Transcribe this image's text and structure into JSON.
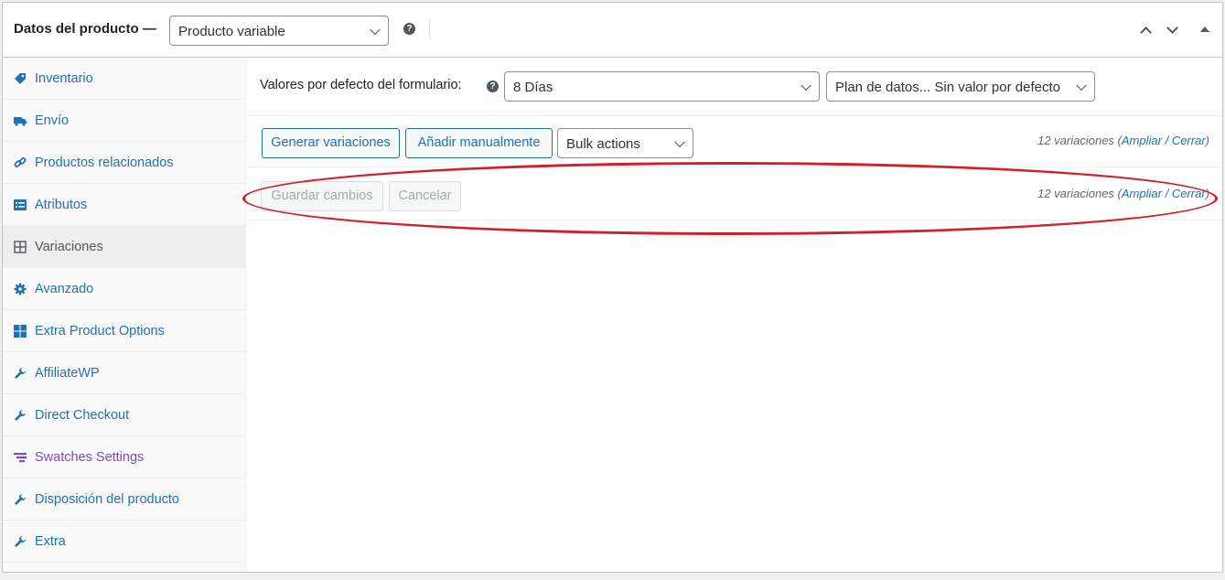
{
  "header": {
    "title": "Datos del producto —",
    "product_type": "Producto variable",
    "help": "?"
  },
  "sidebar": {
    "items": [
      {
        "label": "Inventario",
        "icon": "tag-icon"
      },
      {
        "label": "Envío",
        "icon": "truck-icon"
      },
      {
        "label": "Productos relacionados",
        "icon": "link-icon"
      },
      {
        "label": "Atributos",
        "icon": "list-icon"
      },
      {
        "label": "Variaciones",
        "icon": "grid-icon",
        "active": true
      },
      {
        "label": "Avanzado",
        "icon": "gear-icon"
      },
      {
        "label": "Extra Product Options",
        "icon": "dashboard-icon"
      },
      {
        "label": "AffiliateWP",
        "icon": "wrench-icon"
      },
      {
        "label": "Direct Checkout",
        "icon": "wrench-icon"
      },
      {
        "label": "Swatches Settings",
        "icon": "filter-icon"
      },
      {
        "label": "Disposición del producto",
        "icon": "wrench-icon"
      },
      {
        "label": "Extra",
        "icon": "wrench-icon"
      }
    ]
  },
  "defaults": {
    "label": "Valores por defecto del formulario:",
    "help": "?",
    "select_days": "8 Días",
    "select_plan": "Plan de datos... Sin valor por defecto"
  },
  "toolbar": {
    "generate_label": "Generar variaciones",
    "add_label": "Añadir manualmente",
    "bulk_label": "Bulk actions",
    "count_prefix": "12 variaciones (",
    "expand": "Ampliar",
    "sep": " / ",
    "close": "Cerrar",
    "count_suffix": ")"
  },
  "save_row": {
    "save_label": "Guardar cambios",
    "cancel_label": "Cancelar",
    "count_prefix": "12 variaciones (",
    "expand": "Ampliar",
    "sep": " / ",
    "close": "Cerrar",
    "count_suffix": ")"
  },
  "colors": {
    "link": "#2271b1",
    "highlight": "#d0202b",
    "swatches": "#7c49c4"
  }
}
